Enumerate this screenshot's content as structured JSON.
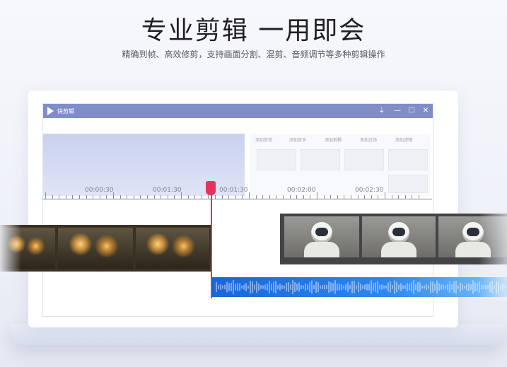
{
  "headline": "专业剪辑 一用即会",
  "subline": "精确到帧、高效修剪，支持画面分割、混剪、音频调节等多种剪辑操作",
  "app": {
    "title": "快剪辑",
    "controls": [
      "⇣",
      "—",
      "☐",
      "✕"
    ],
    "panel_tabs": [
      "添加音效",
      "添加音乐",
      "添加剪辑",
      "添加过场",
      "添加滤镜"
    ]
  },
  "timeline": {
    "labels": [
      "00:00:30",
      "00:01:30",
      "00:01:30",
      "00:02:00",
      "00:02:30"
    ]
  },
  "colors": {
    "titlebar": "#7f8ec7",
    "playhead": "#e8315f",
    "audio": "#2f86ee"
  }
}
